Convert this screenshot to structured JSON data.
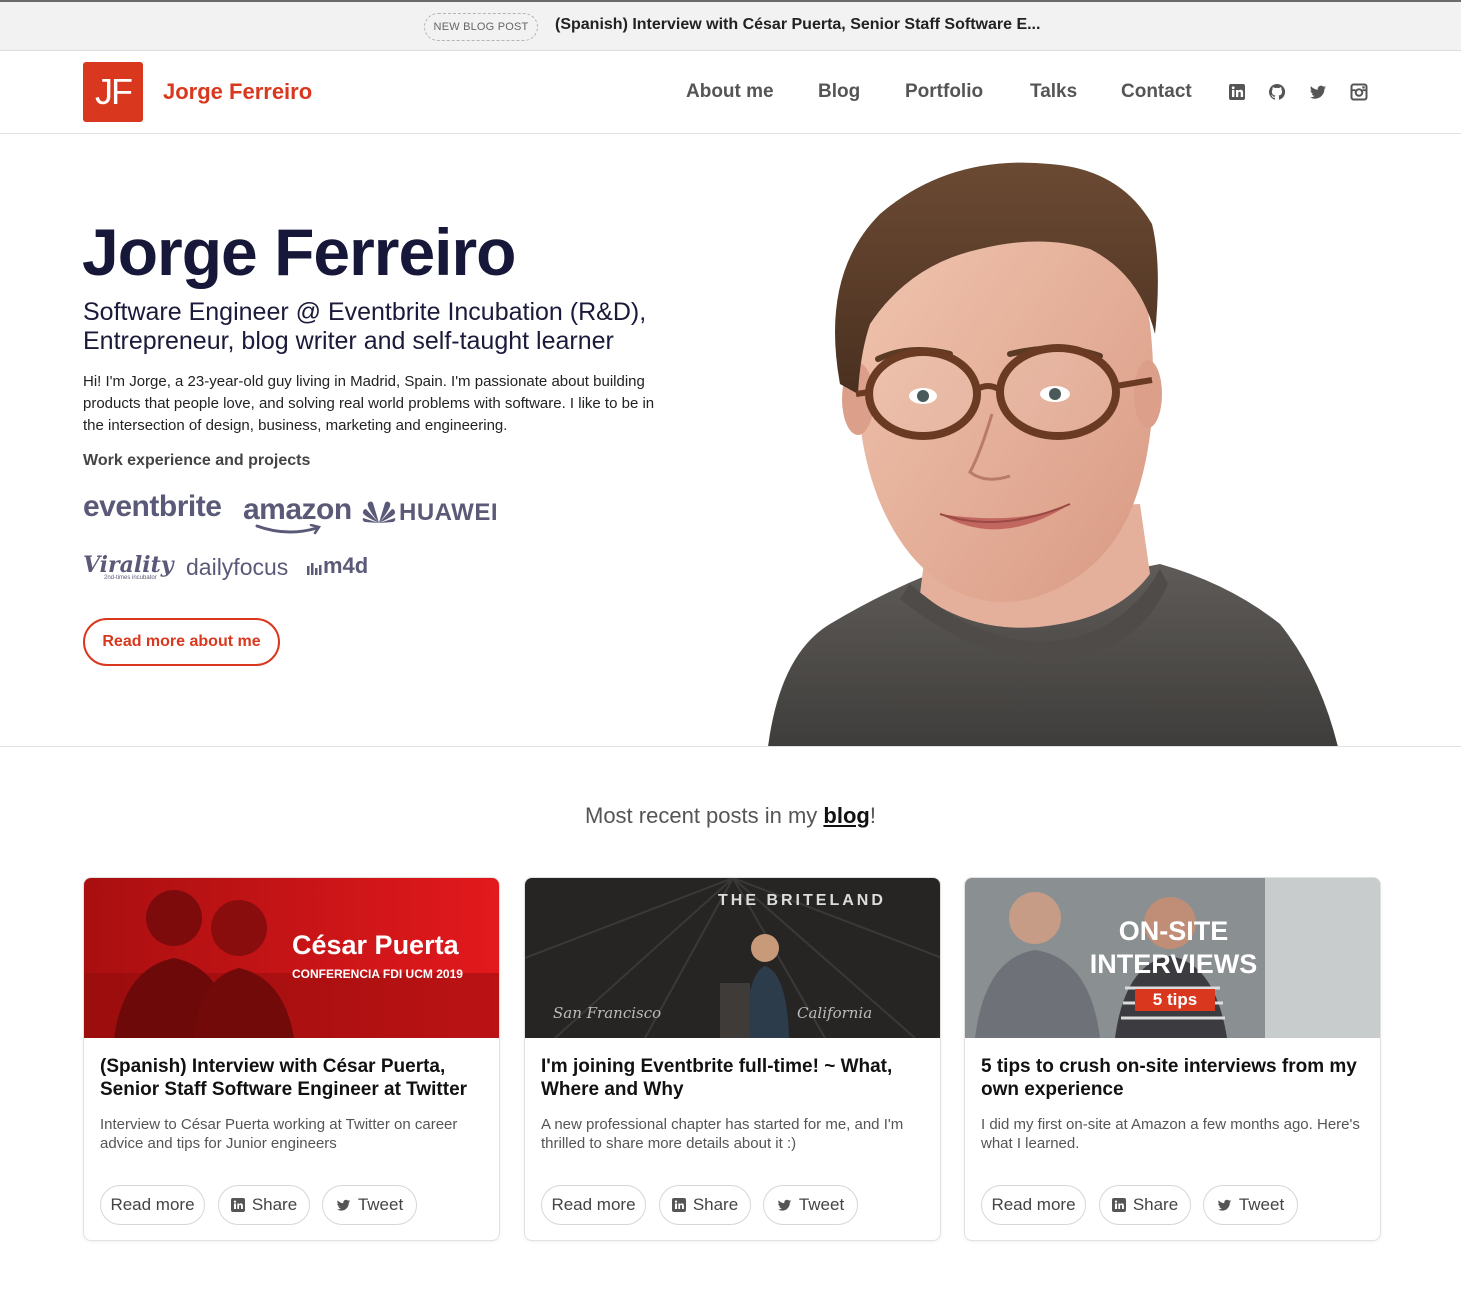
{
  "announcement": {
    "badge": "NEW BLOG POST",
    "headline": "(Spanish) Interview with César Puerta, Senior Staff Software E..."
  },
  "header": {
    "logo": "JF",
    "brand": "Jorge Ferreiro",
    "nav": [
      "About me",
      "Blog",
      "Portfolio",
      "Talks",
      "Contact"
    ],
    "social_icons": [
      "linkedin-icon",
      "github-icon",
      "twitter-icon",
      "instagram-icon"
    ]
  },
  "hero": {
    "name": "Jorge Ferreiro",
    "subtitle": "Software Engineer @ Eventbrite Incubation (R&D), Entrepreneur, blog writer and self-taught learner",
    "bio": "Hi! I'm Jorge, a 23-year-old guy living in Madrid, Spain. I'm passionate about building products that people love, and solving real world problems with software. I like to be in the intersection of design, business, marketing and engineering.",
    "work_label": "Work experience and projects",
    "companies": [
      "eventbrite",
      "amazon",
      "HUAWEI",
      "Virality",
      "dailyfocus",
      "m4d"
    ],
    "virality_tagline": "2nd-times incubator",
    "cta": "Read more about me"
  },
  "blog": {
    "heading_prefix": "Most recent posts in my ",
    "heading_link": "blog",
    "heading_suffix": "!",
    "posts": [
      {
        "thumb_title": "César Puerta",
        "thumb_subtitle": "CONFERENCIA FDI UCM 2019",
        "title": "(Spanish) Interview with César Puerta, Senior Staff Software Engineer at Twitter San Francisco and head of the Android",
        "excerpt": "Interview to César Puerta working at Twitter on career advice and tips for Junior engineers"
      },
      {
        "thumb_title": "THE BRITELAND",
        "thumb_left": "San Francisco",
        "thumb_right": "California",
        "title": "I'm joining Eventbrite full-time! ~ What, Where and Why",
        "excerpt": "A new professional chapter has started for me, and I'm thrilled to share more details about it :)"
      },
      {
        "thumb_title_1": "ON-SITE",
        "thumb_title_2": "INTERVIEWS",
        "thumb_badge": "5 tips",
        "title": "5 tips to crush on-site interviews from my own experience",
        "excerpt": "I did my first on-site at Amazon a few months ago. Here's what I learned."
      }
    ],
    "buttons": {
      "read_more": "Read more",
      "share": "Share",
      "tweet": "Tweet"
    }
  },
  "colors": {
    "accent": "#d9381e",
    "heading": "#17173a"
  }
}
